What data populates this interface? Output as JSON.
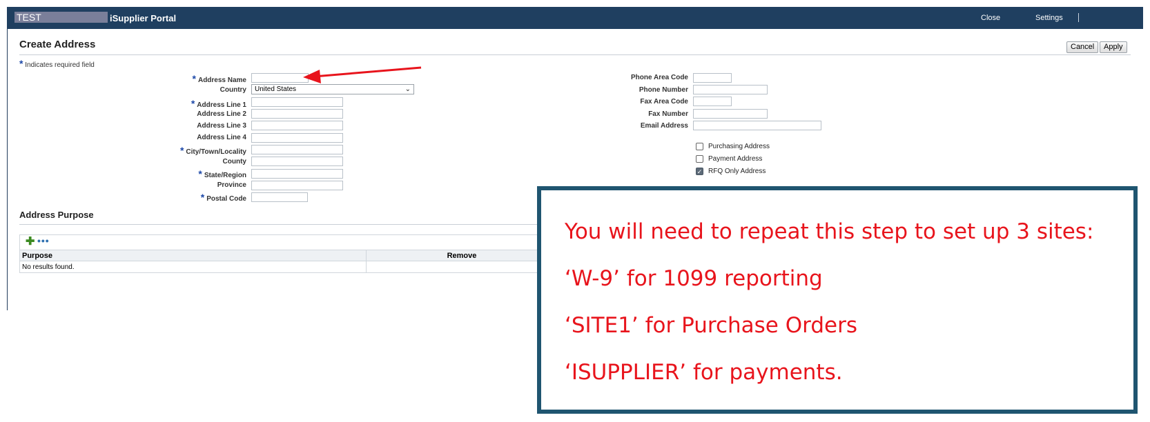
{
  "header": {
    "env_label": "TEST",
    "portal_title": "iSupplier Portal",
    "close_label": "Close",
    "settings_label": "Settings"
  },
  "page": {
    "title": "Create Address",
    "required_note": "Indicates required field",
    "required_mark": "*",
    "cancel_label": "Cancel",
    "apply_label": "Apply"
  },
  "form_left": {
    "address_name": "Address Name",
    "country": "Country",
    "country_value": "United States",
    "address_line_1": "Address Line 1",
    "address_line_2": "Address Line 2",
    "address_line_3": "Address Line 3",
    "address_line_4": "Address Line 4",
    "city": "City/Town/Locality",
    "county": "County",
    "state": "State/Region",
    "province": "Province",
    "postal_code": "Postal Code"
  },
  "form_right": {
    "phone_area_code": "Phone Area Code",
    "phone_number": "Phone Number",
    "fax_area_code": "Fax Area Code",
    "fax_number": "Fax Number",
    "email_address": "Email Address",
    "purchasing_address": "Purchasing Address",
    "purchasing_checked": false,
    "payment_address": "Payment Address",
    "payment_checked": false,
    "rfq_only_address": "RFQ Only Address",
    "rfq_checked": true
  },
  "purpose": {
    "title": "Address Purpose",
    "add_icon": "plus-icon",
    "more_icon": "more-icon",
    "columns": [
      "Purpose",
      "Remove"
    ],
    "empty_message": "No results found."
  },
  "callout": {
    "lines": [
      "You will need to repeat this step to set up 3 sites:",
      "‘W-9’ for 1099 reporting",
      "‘SITE1’ for Purchase Orders",
      "‘ISUPPLIER’ for payments."
    ],
    "text_color": "#e8141c",
    "border_color": "#1f5570"
  },
  "colors": {
    "header_bg": "#1f3f60",
    "arrow": "#e8141c",
    "required_star": "#1c48a8"
  }
}
